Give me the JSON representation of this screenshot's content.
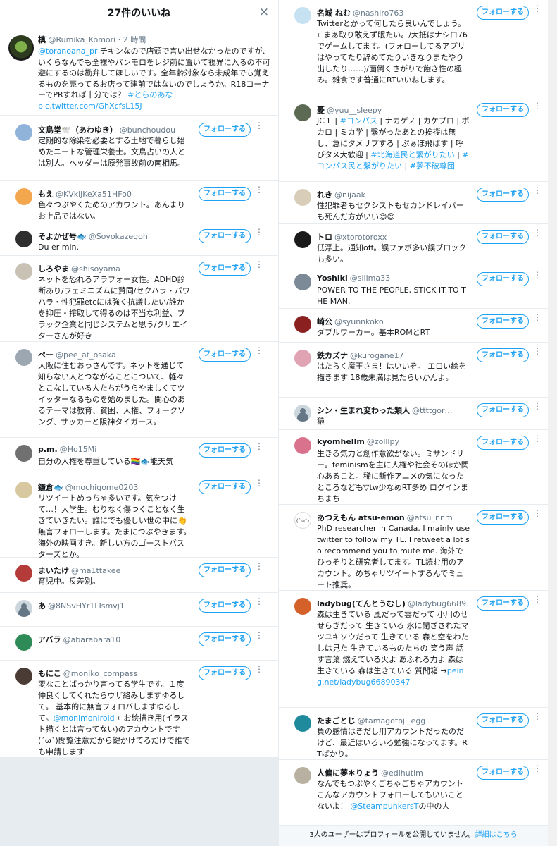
{
  "modal": {
    "title": "27件のいいね",
    "close_icon": "×"
  },
  "tweet": {
    "name": "槙",
    "handle": "@Rumika_Komori",
    "time": "· 2 時間",
    "reply_to": "@toranoana_pr",
    "text": " チキンなので店頭で言い出せなかったのですが、いくらなんでも全裸やパンモロをレジ前に置いて視界に入るの不可避にするのは勘弁してほしいです。全年齢対象なら未成年でも覚えるものを売ってるお店って建前ではないのでしょうか。R18コーナーでPRすれば十分では？ ",
    "hashtag": "#とらのあな",
    "pic_link": "pic.twitter.com/GhXcfsL15J"
  },
  "follow_label": "フォローする",
  "more_icon": "⋮",
  "left_users": [
    {
      "name": "文鳥堂🕊️（あわゆき）",
      "handle": "@bunchoudou",
      "bio": "定期的な除染を必要とする土地で暮らし始めたニートな管理栄養士。文鳥占いの人とは別人。ヘッダーは原発事故前の南相馬。"
    },
    {
      "name": "もえ",
      "handle": "@KVkijKeXa51HFo0",
      "bio": "色々つぶやくためのアカウント。あんまりお上品ではない。"
    },
    {
      "name": "そよかぜ号🐟",
      "handle": "@Soyokazegoh",
      "bio": "Du er min."
    },
    {
      "name": "しろやま",
      "handle": "@shisoyama",
      "bio": "ネットを恐れるアラフォー女性。ADHD診断あり/フェミニズムに賛同/セクハラ・パワハラ・性犯罪etcには強く抗議したい/誰かを抑圧・搾取して得るのは不当な利益、ブラック企業と同じシステムと思う/クリエイターさんが好き"
    },
    {
      "name": "ペー",
      "handle": "@pee_at_osaka",
      "bio": "大阪に住むおっさんです。ネットを通じて知らない人とつながることについて、軽々とこなしている人たちがうらやましくてツイッターなるものを始めました。関心のあるテーマは教育、貧困、人権、フォークソング、サッカーと阪神タイガース。"
    },
    {
      "name": "p.m.",
      "handle": "@Ho15Mi",
      "bio": "自分の人権を尊重している🏳️‍🌈🐟能天気"
    },
    {
      "name": "鎌倉🐟",
      "handle": "@mochigome0203",
      "bio": "リツイートめっちゃ多いです。気をつけて…！大学生。むりなく傷つくことなく生きていきたい。誰にでも優しい世の中に👏無言フォローします。たまにつぶやきます。海外の映画すき。新しい方のゴーストバスターズとか。"
    },
    {
      "name": "まいたけ",
      "handle": "@ma1ttakee",
      "bio": "育児中。反差別。"
    },
    {
      "name": "あ",
      "handle": "@8NSvHYr1LTsmvj1",
      "bio": ""
    },
    {
      "name": "アバラ",
      "handle": "@abarabara10",
      "bio": ""
    },
    {
      "name": "もにこ",
      "handle": "@moniko_compass",
      "bio_parts": [
        "変なことばっかり言ってる学生です。１度仲良くしてくれたらウザ絡みしますゆるして。 基本的に無言フォロバしますゆるして。",
        "@monimoniroid",
        " ←お絵描き用(イラスト描くとは言ってない)のアカウントです(´ω`)閲覧注意だから鍵かけてるだけで誰でも申請します"
      ]
    }
  ],
  "right_users": [
    {
      "name": "名城 ねむ",
      "handle": "@nashiro763",
      "bio": "Twitterとかって何したら良いんでしょう。←まぁ取り敢えず眠たい。/大抵はナシロ76でゲームしてます。(フォローしてるアプリはやってたり辞めてたりいきなりまたやり出したり……)/面倒くさがりで飽き性の極み。雑食です普通にRTいいねします。"
    },
    {
      "name": "憂",
      "handle": "@yuu__sleepy",
      "bio_parts": [
        "JC１ | ",
        "#コンパス",
        " | ナカゲノ | カケプロ | ボカロ | ミカ学 | 繋がったあとの挨拶は無し、急にタメリプする | ぷぁぼ飛ばす | 呼びタメ大歓迎 | ",
        "#北海道民と繋がりたい",
        " | ",
        "#コンパス民と繋がりたい",
        " | ",
        "#夢不破尊団"
      ]
    },
    {
      "name": "れき",
      "handle": "@nijaak",
      "bio": "性犯罪者もセクシストもセカンドレイパーも死んだ方がいい😊😊"
    },
    {
      "name": "トロ",
      "handle": "@xtorotoroxx",
      "bio": "低浮上。通知off。誤ファボ多い誤ブロックも多い。"
    },
    {
      "name": "Yoshiki",
      "handle": "@siiima33",
      "bio": "POWER TO THE PEOPLE, STICK IT TO THE MAN."
    },
    {
      "name": "崎公",
      "handle": "@syunnkoko",
      "bio": "ダブルワーカー。基本ROMとRT"
    },
    {
      "name": "鉄カズナ",
      "handle": "@kurogane17",
      "bio": "はたらく魔王さま！はいいぞ。 エロい絵を描きます 18歳未満は見たらいかんよ。"
    },
    {
      "name": "シン・生まれ変わった類人",
      "handle": "@ttttgor…",
      "bio": "猿"
    },
    {
      "name": "kyomhellm",
      "handle": "@zolllpy",
      "bio": "生きる気力と創作意欲がない。ミサンドリー。feminismを主に人権や社会そのほか関心あること。稀に新作アニメの気になったところなども▽tw少なめRT多め ログインまちまち"
    },
    {
      "name": "あつえもん atsu-emon",
      "handle": "@atsu_nnm",
      "avatar_text": "(ˆωˆ)",
      "bio": "PhD researcher in Canada. I mainly use twitter to follow my TL. I retweet a lot so recommend you to mute me. 海外でひっそりと研究者してます。TL読む用のアカウント。めちゃリツイートするんでミュート推奨。"
    },
    {
      "name": "ladybug(てんとうむし)",
      "handle": "@ladybug6689…",
      "bio_parts": [
        "森は生きている 風だって雲だって 小川のせせらぎだって 生きている 氷に閉ざされたマツユキソウだって 生きている 森と空をわたしは見た 生きているものたちの 笑う声 話す言葉 燃えている火よ あふれる力よ 森は生きている 森は生きている 質問箱 →",
        "peing.net/ladybug66890347"
      ]
    },
    {
      "name": "たまごとじ",
      "handle": "@tamagotoji_egg",
      "bio": "負の感情はきだし用アカウントだったのだけど、最近はいろいろ勉強になってます。RTばかり。"
    },
    {
      "name": "人偏に夢＊りょう",
      "handle": "@edihutim",
      "bio_parts": [
        "なんでもつぶやくごちゃごちゃアカウント こんなアカウントフォローしてもいいことないよ！ ",
        "@SteampunkersT",
        "の中の人"
      ]
    }
  ],
  "footer": {
    "text": "3人のユーザーはプロフィールを公開していません。",
    "link": "詳細はこちら"
  }
}
